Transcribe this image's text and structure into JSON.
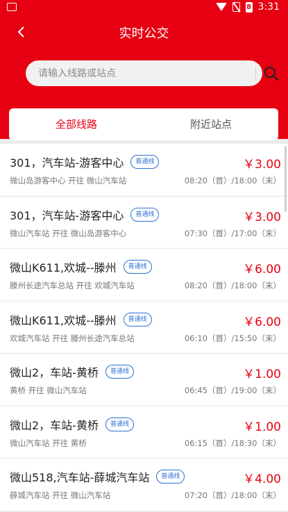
{
  "status_bar": {
    "time": "3:31",
    "battery_label": "8"
  },
  "header": {
    "title": "实时公交",
    "back_icon": "chevron-left-icon"
  },
  "search": {
    "placeholder": "请输入线路或站点",
    "icon": "search-icon"
  },
  "tabs": [
    {
      "label": "全部线路",
      "active": true
    },
    {
      "label": "附近站点",
      "active": false
    }
  ],
  "colors": {
    "brand_red": "#e60012",
    "badge_blue": "#2c6fd4"
  },
  "routes": [
    {
      "name": "301，汽车站-游客中心",
      "badge": "普通线",
      "price": "￥3.00",
      "stations": "微山岛游客中心 开往 微山汽车站",
      "times": "08:20（首）/18:00（末）"
    },
    {
      "name": "301，汽车站-游客中心",
      "badge": "普通线",
      "price": "￥3.00",
      "stations": "微山汽车站 开往 微山岛游客中心",
      "times": "07:30（首）/17:00（末）"
    },
    {
      "name": "微山K611,欢城--滕州",
      "badge": "普通线",
      "price": "￥6.00",
      "stations": "滕州长途汽车总站 开往 欢城汽车站",
      "times": "08:20（首）/18:00（末）"
    },
    {
      "name": "微山K611,欢城--滕州",
      "badge": "普通线",
      "price": "￥6.00",
      "stations": "欢城汽车站 开往 滕州长途汽车总站",
      "times": "06:10（首）/15:50（末）"
    },
    {
      "name": "微山2，车站-黄桥",
      "badge": "普通线",
      "price": "￥1.00",
      "stations": "黄桥 开往 微山汽车站",
      "times": "06:45（首）/19:00（末）"
    },
    {
      "name": "微山2，车站-黄桥",
      "badge": "普通线",
      "price": "￥1.00",
      "stations": "微山汽车站 开往 黄桥",
      "times": "06:15（首）/18:30（末）"
    },
    {
      "name": "微山518,汽车站-薛城汽车站",
      "badge": "普通线",
      "price": "￥4.00",
      "stations": "薛城汽车站 开往 微山汽车站",
      "times": "07:20（首）/18:00（末）"
    }
  ]
}
